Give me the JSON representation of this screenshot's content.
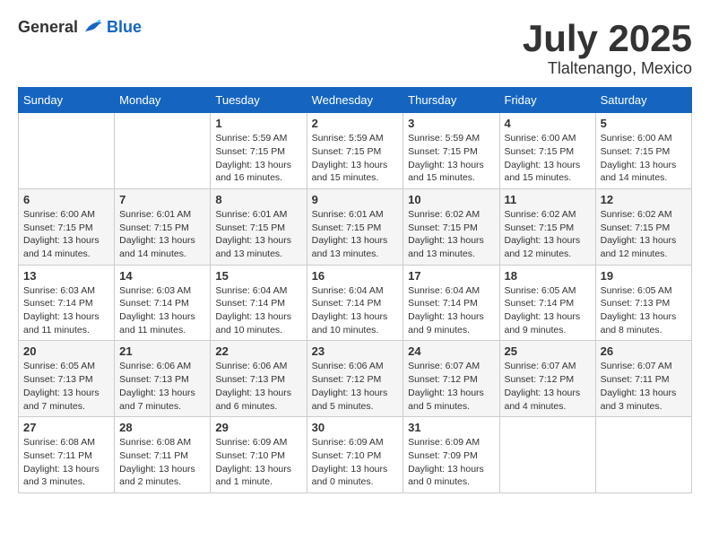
{
  "header": {
    "logo_general": "General",
    "logo_blue": "Blue",
    "month": "July 2025",
    "location": "Tlaltenango, Mexico"
  },
  "days_of_week": [
    "Sunday",
    "Monday",
    "Tuesday",
    "Wednesday",
    "Thursday",
    "Friday",
    "Saturday"
  ],
  "weeks": [
    [
      {
        "day": "",
        "detail": ""
      },
      {
        "day": "",
        "detail": ""
      },
      {
        "day": "1",
        "detail": "Sunrise: 5:59 AM\nSunset: 7:15 PM\nDaylight: 13 hours\nand 16 minutes."
      },
      {
        "day": "2",
        "detail": "Sunrise: 5:59 AM\nSunset: 7:15 PM\nDaylight: 13 hours\nand 15 minutes."
      },
      {
        "day": "3",
        "detail": "Sunrise: 5:59 AM\nSunset: 7:15 PM\nDaylight: 13 hours\nand 15 minutes."
      },
      {
        "day": "4",
        "detail": "Sunrise: 6:00 AM\nSunset: 7:15 PM\nDaylight: 13 hours\nand 15 minutes."
      },
      {
        "day": "5",
        "detail": "Sunrise: 6:00 AM\nSunset: 7:15 PM\nDaylight: 13 hours\nand 14 minutes."
      }
    ],
    [
      {
        "day": "6",
        "detail": "Sunrise: 6:00 AM\nSunset: 7:15 PM\nDaylight: 13 hours\nand 14 minutes."
      },
      {
        "day": "7",
        "detail": "Sunrise: 6:01 AM\nSunset: 7:15 PM\nDaylight: 13 hours\nand 14 minutes."
      },
      {
        "day": "8",
        "detail": "Sunrise: 6:01 AM\nSunset: 7:15 PM\nDaylight: 13 hours\nand 13 minutes."
      },
      {
        "day": "9",
        "detail": "Sunrise: 6:01 AM\nSunset: 7:15 PM\nDaylight: 13 hours\nand 13 minutes."
      },
      {
        "day": "10",
        "detail": "Sunrise: 6:02 AM\nSunset: 7:15 PM\nDaylight: 13 hours\nand 13 minutes."
      },
      {
        "day": "11",
        "detail": "Sunrise: 6:02 AM\nSunset: 7:15 PM\nDaylight: 13 hours\nand 12 minutes."
      },
      {
        "day": "12",
        "detail": "Sunrise: 6:02 AM\nSunset: 7:15 PM\nDaylight: 13 hours\nand 12 minutes."
      }
    ],
    [
      {
        "day": "13",
        "detail": "Sunrise: 6:03 AM\nSunset: 7:14 PM\nDaylight: 13 hours\nand 11 minutes."
      },
      {
        "day": "14",
        "detail": "Sunrise: 6:03 AM\nSunset: 7:14 PM\nDaylight: 13 hours\nand 11 minutes."
      },
      {
        "day": "15",
        "detail": "Sunrise: 6:04 AM\nSunset: 7:14 PM\nDaylight: 13 hours\nand 10 minutes."
      },
      {
        "day": "16",
        "detail": "Sunrise: 6:04 AM\nSunset: 7:14 PM\nDaylight: 13 hours\nand 10 minutes."
      },
      {
        "day": "17",
        "detail": "Sunrise: 6:04 AM\nSunset: 7:14 PM\nDaylight: 13 hours\nand 9 minutes."
      },
      {
        "day": "18",
        "detail": "Sunrise: 6:05 AM\nSunset: 7:14 PM\nDaylight: 13 hours\nand 9 minutes."
      },
      {
        "day": "19",
        "detail": "Sunrise: 6:05 AM\nSunset: 7:13 PM\nDaylight: 13 hours\nand 8 minutes."
      }
    ],
    [
      {
        "day": "20",
        "detail": "Sunrise: 6:05 AM\nSunset: 7:13 PM\nDaylight: 13 hours\nand 7 minutes."
      },
      {
        "day": "21",
        "detail": "Sunrise: 6:06 AM\nSunset: 7:13 PM\nDaylight: 13 hours\nand 7 minutes."
      },
      {
        "day": "22",
        "detail": "Sunrise: 6:06 AM\nSunset: 7:13 PM\nDaylight: 13 hours\nand 6 minutes."
      },
      {
        "day": "23",
        "detail": "Sunrise: 6:06 AM\nSunset: 7:12 PM\nDaylight: 13 hours\nand 5 minutes."
      },
      {
        "day": "24",
        "detail": "Sunrise: 6:07 AM\nSunset: 7:12 PM\nDaylight: 13 hours\nand 5 minutes."
      },
      {
        "day": "25",
        "detail": "Sunrise: 6:07 AM\nSunset: 7:12 PM\nDaylight: 13 hours\nand 4 minutes."
      },
      {
        "day": "26",
        "detail": "Sunrise: 6:07 AM\nSunset: 7:11 PM\nDaylight: 13 hours\nand 3 minutes."
      }
    ],
    [
      {
        "day": "27",
        "detail": "Sunrise: 6:08 AM\nSunset: 7:11 PM\nDaylight: 13 hours\nand 3 minutes."
      },
      {
        "day": "28",
        "detail": "Sunrise: 6:08 AM\nSunset: 7:11 PM\nDaylight: 13 hours\nand 2 minutes."
      },
      {
        "day": "29",
        "detail": "Sunrise: 6:09 AM\nSunset: 7:10 PM\nDaylight: 13 hours\nand 1 minute."
      },
      {
        "day": "30",
        "detail": "Sunrise: 6:09 AM\nSunset: 7:10 PM\nDaylight: 13 hours\nand 0 minutes."
      },
      {
        "day": "31",
        "detail": "Sunrise: 6:09 AM\nSunset: 7:09 PM\nDaylight: 13 hours\nand 0 minutes."
      },
      {
        "day": "",
        "detail": ""
      },
      {
        "day": "",
        "detail": ""
      }
    ]
  ]
}
